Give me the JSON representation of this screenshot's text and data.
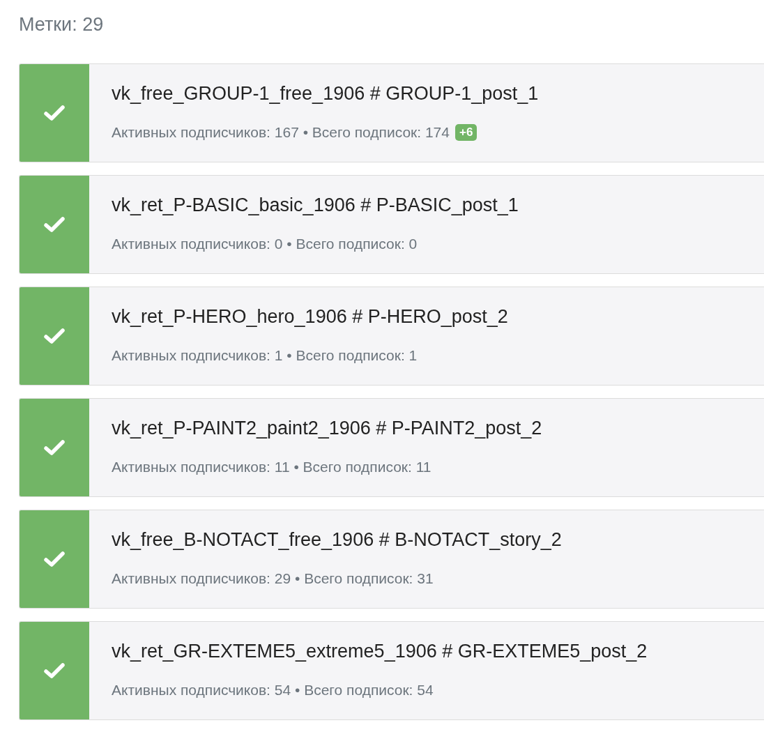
{
  "header": "Метки: 29",
  "tags": [
    {
      "done": true,
      "title": "vk_free_GROUP-1_free_1906 # GROUP-1_post_1",
      "stats": "Активных подписчиков: 167 • Всего подписок: 174",
      "badge": "+6"
    },
    {
      "done": true,
      "title": "vk_ret_P-BASIC_basic_1906 # P-BASIC_post_1",
      "stats": "Активных подписчиков: 0 • Всего подписок: 0"
    },
    {
      "done": true,
      "title": "vk_ret_P-HERO_hero_1906 # P-HERO_post_2",
      "stats": "Активных подписчиков: 1 • Всего подписок: 1"
    },
    {
      "done": true,
      "title": "vk_ret_P-PAINT2_paint2_1906 # P-PAINT2_post_2",
      "stats": "Активных подписчиков: 11 • Всего подписок: 11"
    },
    {
      "done": true,
      "title": "vk_free_B-NOTACT_free_1906 # B-NOTACT_story_2",
      "stats": "Активных подписчиков: 29 • Всего подписок: 31"
    },
    {
      "done": true,
      "title": "vk_ret_GR-EXTEME5_extreme5_1906 # GR-EXTEME5_post_2",
      "stats": "Активных подписчиков: 54 • Всего подписок: 54"
    }
  ]
}
